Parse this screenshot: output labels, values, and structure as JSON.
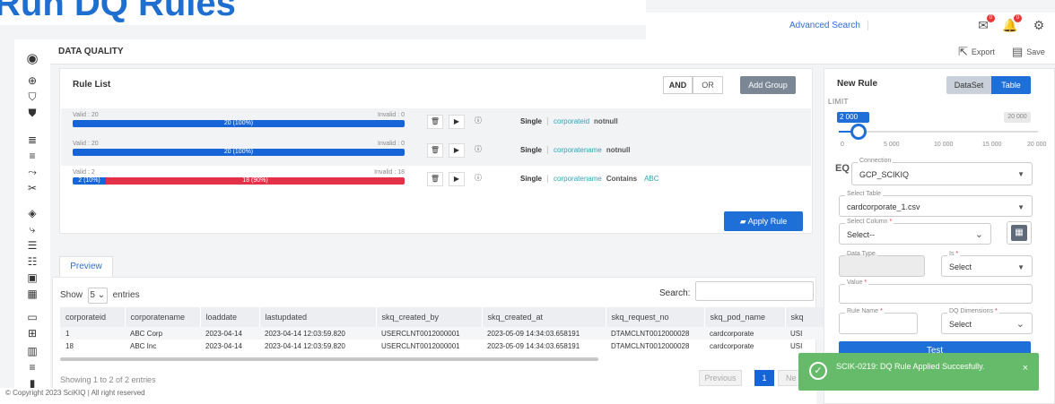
{
  "banner": {
    "title": "Run DQ Rules"
  },
  "topbar": {
    "advanced_search": "Advanced Search",
    "mail_badge": "0",
    "bell_badge": "0"
  },
  "header": {
    "page_title": "DATA QUALITY",
    "export_label": "Export",
    "save_label": "Save"
  },
  "sidebar": {
    "icons": [
      "user-circle-icon",
      "globe-icon",
      "shield-check-icon",
      "shield-user-icon",
      "database-icon",
      "database-arrow-icon",
      "branch-icon",
      "scissors-icon",
      "cube-icon",
      "flow-icon",
      "list-icon",
      "list-check-icon",
      "calendar-check-icon",
      "calendar-icon",
      "monitor-icon",
      "grid-icon",
      "bar-chart-icon",
      "menu-icon",
      "book-icon"
    ]
  },
  "rule_list": {
    "title": "Rule List",
    "and_label": "AND",
    "or_label": "OR",
    "add_group_label": "Add Group",
    "apply_label": "Apply Rule",
    "rules": [
      {
        "valid": "Valid : 20",
        "invalid": "Invalid : 0",
        "ok_label": "20 (100%)",
        "bad_label": "",
        "ok_fraction": 1.0,
        "type": "Single",
        "column": "corporateid",
        "op": "notnull",
        "value": ""
      },
      {
        "valid": "Valid : 20",
        "invalid": "Invalid : 0",
        "ok_label": "20 (100%)",
        "bad_label": "",
        "ok_fraction": 1.0,
        "type": "Single",
        "column": "corporatename",
        "op": "notnull",
        "value": ""
      },
      {
        "valid": "Valid : 2",
        "invalid": "Invalid : 18",
        "ok_label": "2 (10%)",
        "bad_label": "18 (90%)",
        "ok_fraction": 0.1,
        "type": "Single",
        "column": "corporatename",
        "op": "Contains",
        "value": "ABC"
      }
    ]
  },
  "preview": {
    "tab_label": "Preview",
    "show_label": "Show",
    "entries_value": "5",
    "entries_label": "entries",
    "search_label": "Search:",
    "columns": [
      "corporateid",
      "corporatename",
      "loaddate",
      "lastupdated",
      "skq_created_by",
      "skq_created_at",
      "skq_request_no",
      "skq_pod_name",
      "skq"
    ],
    "rows": [
      [
        "1",
        "ABC Corp",
        "2023-04-14",
        "2023-04-14 12:03:59.820",
        "USERCLNT0012000001",
        "2023-05-09 14:34:03.658191",
        "DTAMCLNT0012000028",
        "cardcorporate",
        "USI"
      ],
      [
        "18",
        "ABC Inc",
        "2023-04-14",
        "2023-04-14 12:03:59.820",
        "USERCLNT0012000001",
        "2023-05-09 14:34:03.658191",
        "DTAMCLNT0012000028",
        "cardcorporate",
        "USI"
      ]
    ],
    "showing": "Showing 1 to 2 of 2 entries",
    "prev_label": "Previous",
    "page": "1",
    "next_label": "Ne"
  },
  "footer": {
    "text": "© Copyright 2023 SciKIQ | All right reserved"
  },
  "new_rule": {
    "title": "New Rule",
    "dataset_label": "DataSet",
    "table_label": "Table",
    "limit_label": "LIMIT",
    "limit_value": "2 000",
    "limit_max": "20 000",
    "limit_fraction": 0.1,
    "ticks": [
      "0",
      "5 000",
      "10 000",
      "15 000",
      "20 000"
    ],
    "connection_label": "Connection",
    "connection_value": "GCP_SCIKIQ",
    "eq_icon": "EQ",
    "table_field_label": "Select Table",
    "table_field_value": "cardcorporate_1.csv",
    "column_field_label": "Select Column",
    "column_field_value": "Select--",
    "data_type_label": "Data Type",
    "is_label": "Is",
    "is_value": "Select",
    "value_label": "Value",
    "rule_name_label": "Rule Name",
    "dq_dim_label": "DQ Dimensions",
    "dq_dim_value": "Select",
    "test_label": "Test"
  },
  "toast": {
    "message": "SCIK-0219: DQ Rule Applied Succesfully.",
    "close": "×"
  }
}
